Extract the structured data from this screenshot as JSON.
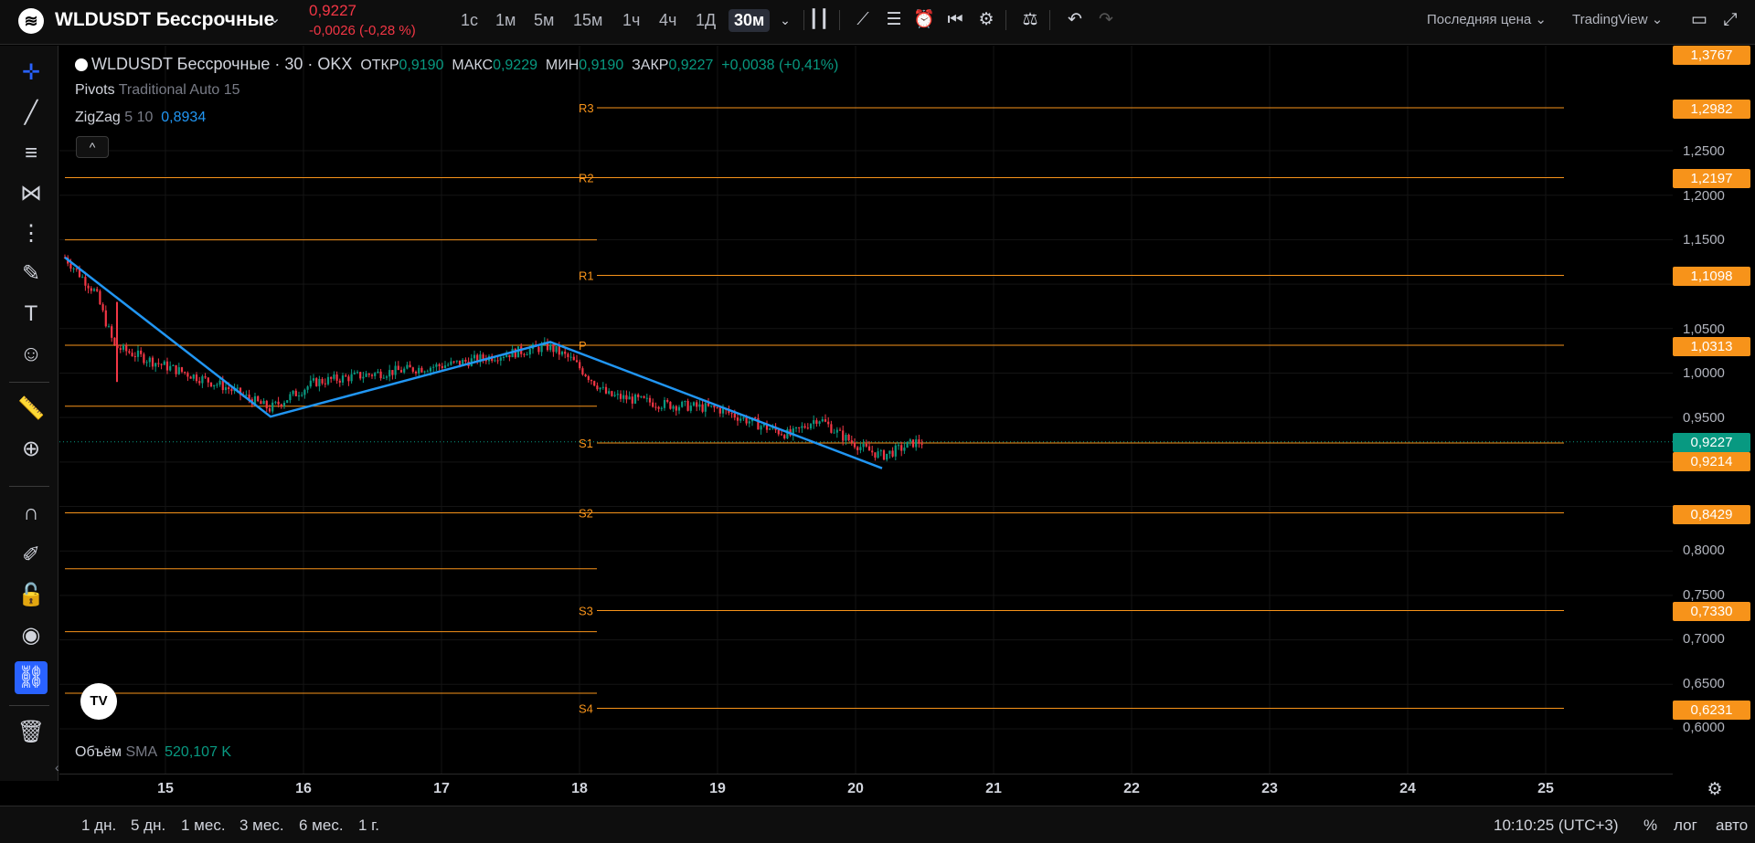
{
  "header": {
    "symbol": "WLDUSDT Бессрочные",
    "last_price": "0,9227",
    "change": "-0,0026 (-0,28 %)",
    "timeframes": [
      "1с",
      "1м",
      "5м",
      "15м",
      "1ч",
      "4ч",
      "1Д",
      "30м"
    ],
    "active_timeframe": "30м",
    "price_source": "Последняя цена",
    "provider": "TradingView"
  },
  "legend": {
    "title": "WLDUSDT Бессрочные · 30 · OKX",
    "o_label": "ОТКР",
    "o_val": "0,9190",
    "h_label": "МАКС",
    "h_val": "0,9229",
    "l_label": "МИН",
    "l_val": "0,9190",
    "c_label": "ЗАКР",
    "c_val": "0,9227",
    "chg": "+0,0038 (+0,41%)",
    "pivots_name": "Pivots",
    "pivots_params": "Traditional Auto 15",
    "zigzag_name": "ZigZag",
    "zigzag_params": "5 10",
    "zigzag_val": "0,8934",
    "volume_name": "Объём",
    "volume_sma": "SMA",
    "volume_val": "520,107 K"
  },
  "price_axis": {
    "labels": [
      "1,2500",
      "1,2000",
      "1,1500",
      "1,0500",
      "1,0000",
      "0,9500",
      "0,8000",
      "0,7500",
      "0,7000",
      "0,6500",
      "0,6000"
    ],
    "badges": [
      {
        "text": "1,3767",
        "color": "orange"
      },
      {
        "text": "1,2982",
        "color": "orange"
      },
      {
        "text": "1,2197",
        "color": "orange"
      },
      {
        "text": "1,1098",
        "color": "orange"
      },
      {
        "text": "1,0313",
        "color": "orange"
      },
      {
        "text": "0,9227",
        "color": "green"
      },
      {
        "text": "0,9214",
        "color": "orange"
      },
      {
        "text": "0,8429",
        "color": "orange"
      },
      {
        "text": "0,7330",
        "color": "orange"
      },
      {
        "text": "0,6231",
        "color": "orange"
      }
    ]
  },
  "pivot_labels": [
    "R3",
    "R2",
    "R1",
    "P",
    "S1",
    "S2",
    "S3",
    "S4"
  ],
  "time_axis": [
    "15",
    "16",
    "17",
    "18",
    "19",
    "20",
    "21",
    "22",
    "23",
    "24",
    "25"
  ],
  "ranges": [
    "1 дн.",
    "5 дн.",
    "1 мес.",
    "3 мес.",
    "6 мес.",
    "1 г."
  ],
  "footer": {
    "clock": "10:10:25 (UTC+3)",
    "percent": "%",
    "log": "лог",
    "auto": "авто"
  },
  "colors": {
    "bg": "#000000",
    "pivot": "#f7931a",
    "zigzag": "#2196f3",
    "up": "#089981",
    "down": "#f23645"
  }
}
